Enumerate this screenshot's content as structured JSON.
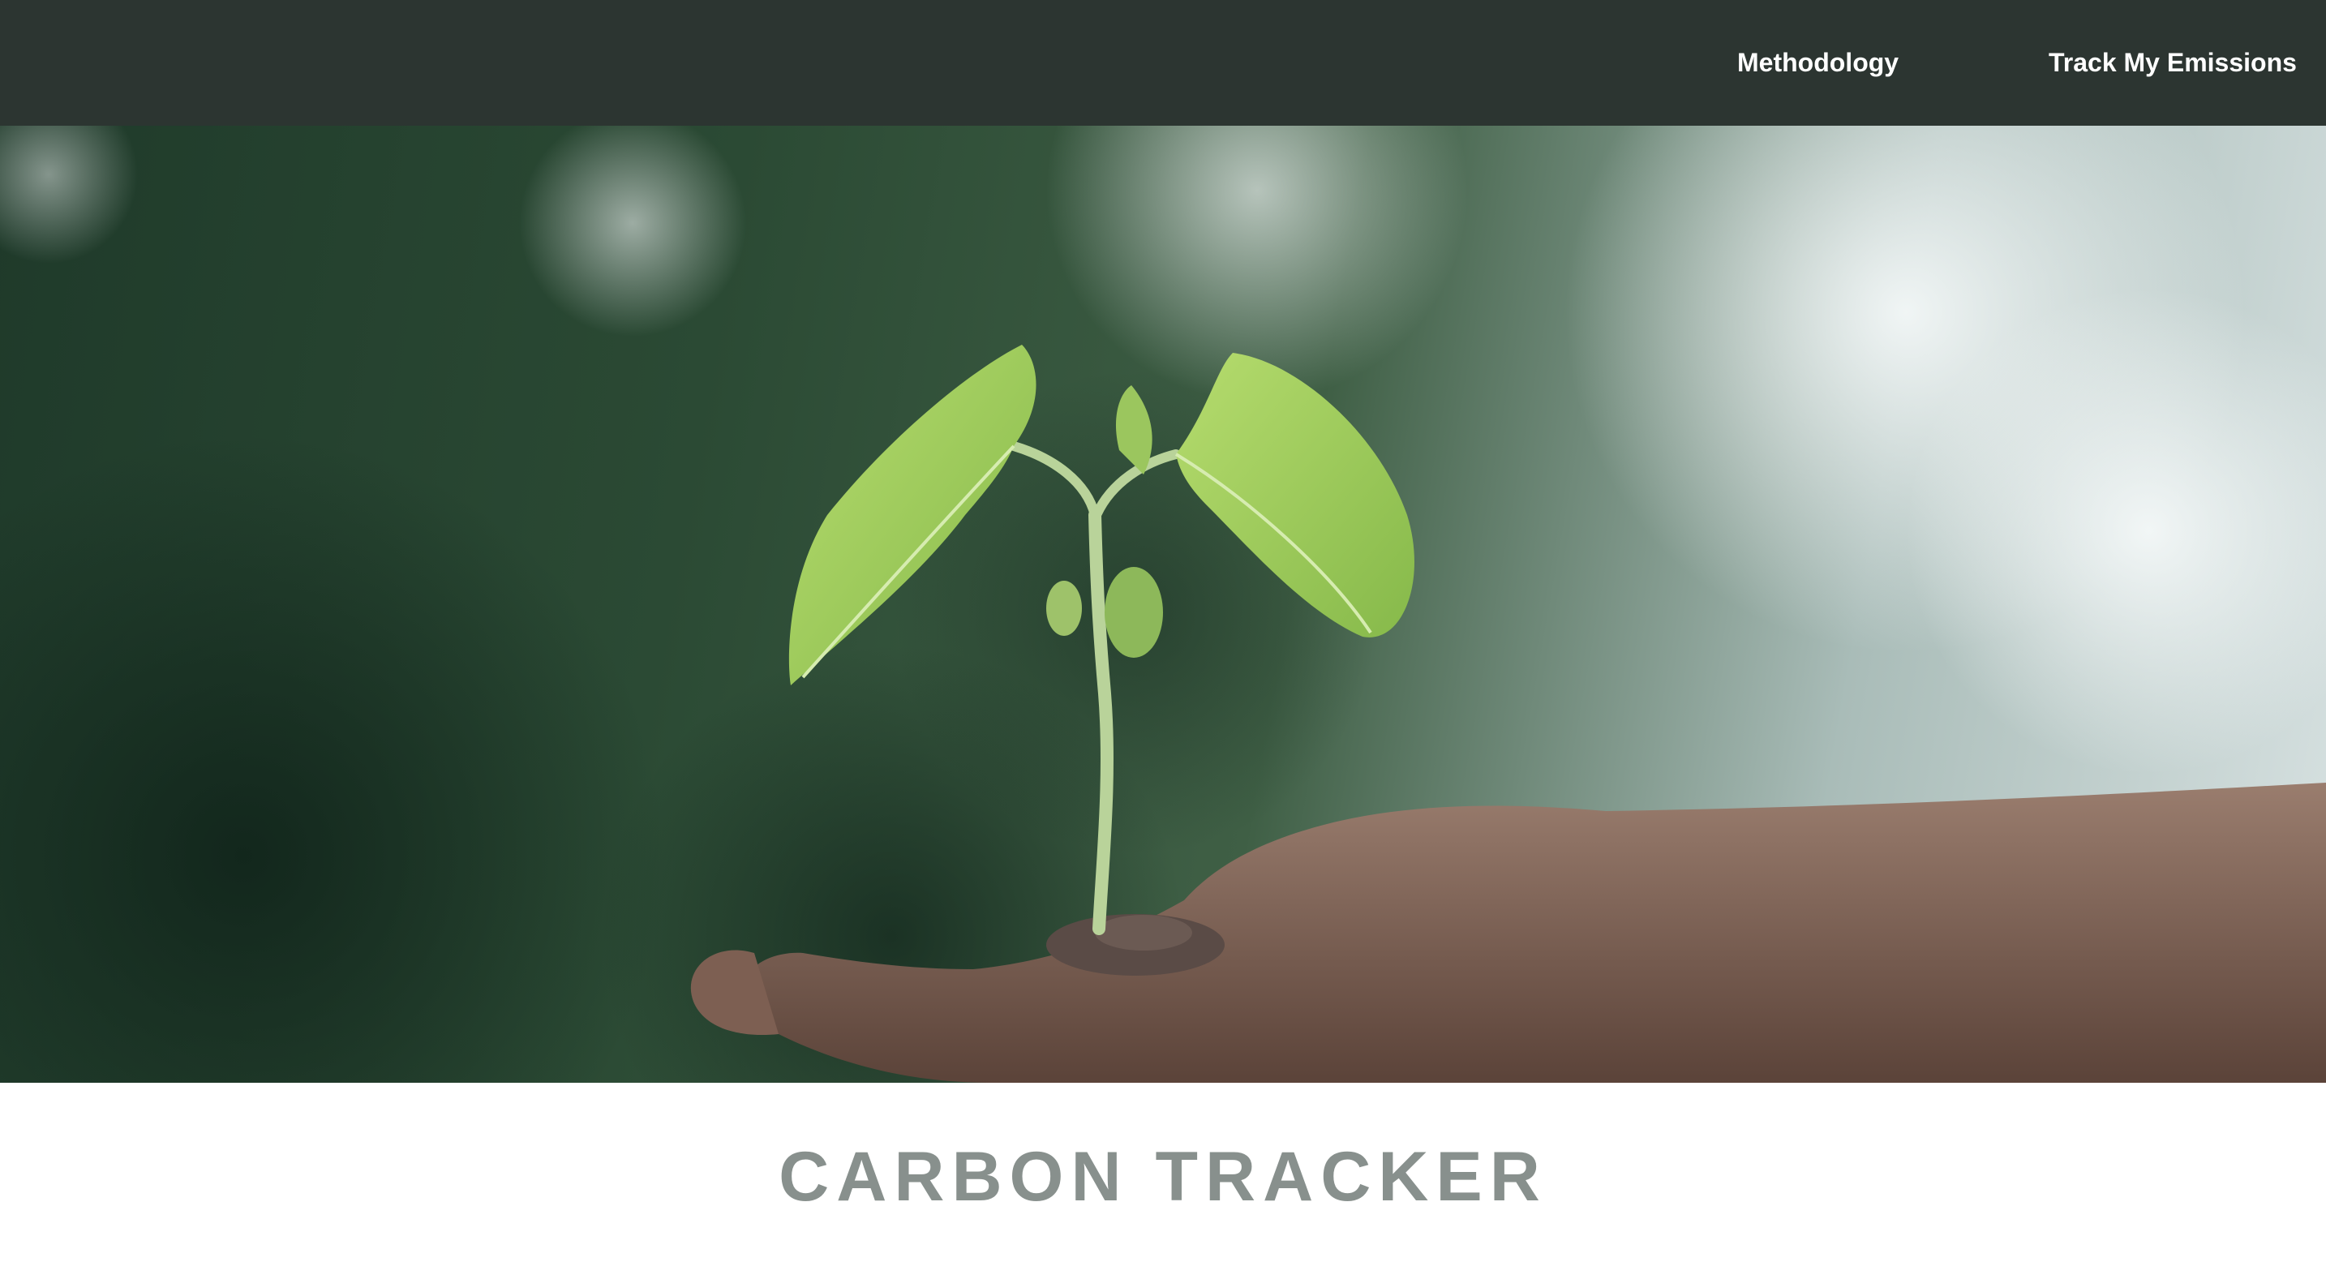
{
  "nav": {
    "links": [
      {
        "label": "Methodology"
      },
      {
        "label": "Track My Emissions"
      }
    ]
  },
  "hero": {
    "image": "hand-holding-seedling"
  },
  "page": {
    "title": "CARBON TRACKER"
  },
  "colors": {
    "nav_background": "#2c3531",
    "nav_text": "#ffffff",
    "title_text": "#88908d",
    "page_background": "#ffffff"
  }
}
